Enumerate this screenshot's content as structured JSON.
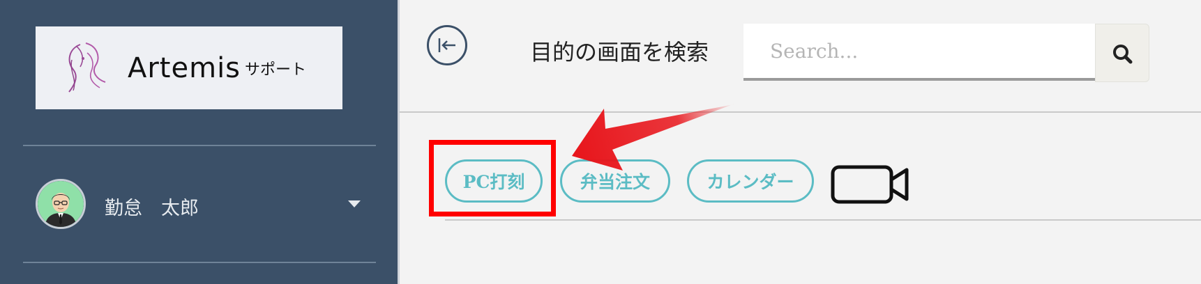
{
  "sidebar": {
    "logo": {
      "brand": "Artemis",
      "sub": "サポート"
    },
    "user": {
      "name": "勤怠　太郎"
    }
  },
  "header": {
    "collapse_icon": "collapse-left-icon",
    "search_label": "目的の画面を検索",
    "search_placeholder": "Search...",
    "search_icon": "search-icon"
  },
  "tags": [
    {
      "label": "PC打刻"
    },
    {
      "label": "弁当注文"
    },
    {
      "label": "カレンダー"
    }
  ],
  "extra_icon": "video-camera-icon",
  "annotation": {
    "highlight_color": "#ff0000",
    "arrow_color": "#e8151b"
  },
  "colors": {
    "sidebar": "#3b5068",
    "accent": "#5bbcc4"
  }
}
